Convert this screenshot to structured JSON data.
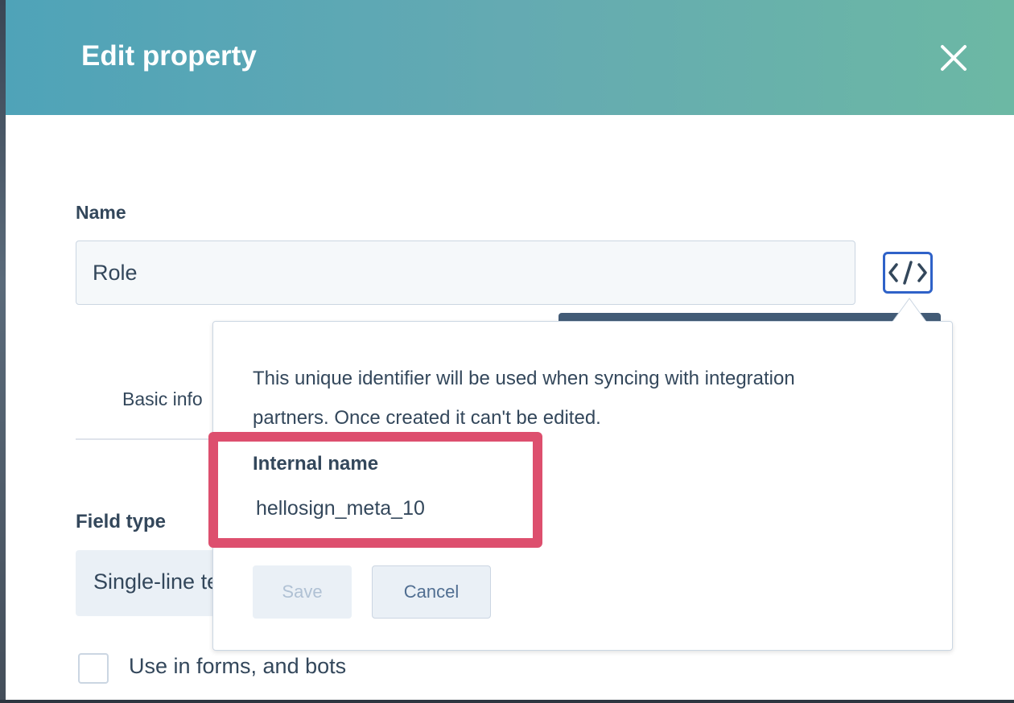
{
  "header": {
    "title": "Edit property",
    "close_icon": "close-icon"
  },
  "form": {
    "name_label": "Name",
    "name_value": "Role",
    "tab_partial_label": "Basic info",
    "field_type_label": "Field type",
    "field_type_value": "Single-line text",
    "checkbox_label": "Use in forms, and bots",
    "code_icon": "code-icon"
  },
  "popover": {
    "description": "This unique identifier will be used when syncing with integration partners. Once created it can't be edited.",
    "internal_name_label": "Internal name",
    "internal_name_value": "hellosign_meta_10",
    "save_label": "Save",
    "cancel_label": "Cancel"
  },
  "colors": {
    "header_start": "#4fa3b8",
    "header_end": "#6cb8a4",
    "highlight": "#dd4f6e",
    "code_button_border": "#2f62c8"
  }
}
